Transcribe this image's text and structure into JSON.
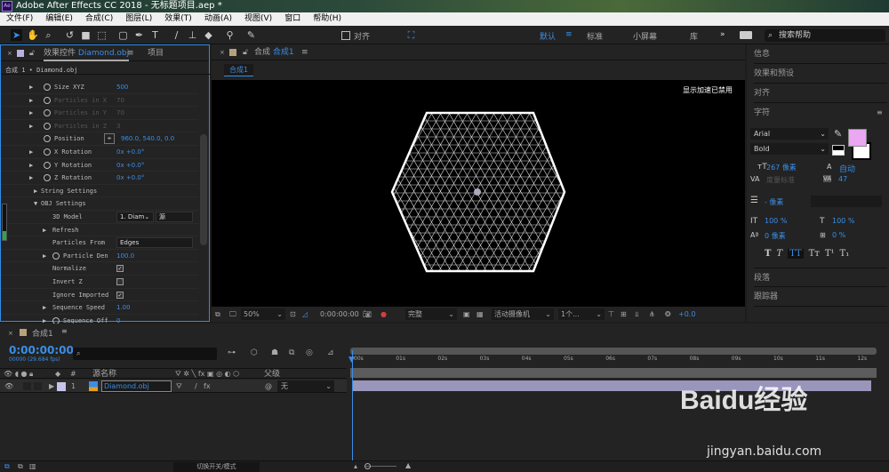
{
  "app": {
    "logo": "Ae",
    "title": "Adobe After Effects CC 2018 - 无标题项目.aep *"
  },
  "menu": [
    "文件(F)",
    "编辑(E)",
    "合成(C)",
    "图层(L)",
    "效果(T)",
    "动画(A)",
    "视图(V)",
    "窗口",
    "帮助(H)"
  ],
  "toolbar": {
    "align_label": "对齐",
    "workspaces": [
      "默认",
      "标准",
      "小屏幕",
      "库"
    ],
    "more": "»",
    "search_placeholder": "搜索帮助"
  },
  "effects_panel": {
    "tab_label": "效果控件",
    "layer_name": "Diamond.obj",
    "project_tab": "项目",
    "breadcrumb": "合成 1 • Diamond.obj",
    "rows": [
      {
        "label": "Size XYZ",
        "value": "500"
      },
      {
        "label": "Particles in X",
        "value": "70"
      },
      {
        "label": "Particles in Y",
        "value": "70"
      },
      {
        "label": "Particles in Z",
        "value": "3"
      },
      {
        "label": "Position",
        "value": "960.0, 540.0, 0.0"
      },
      {
        "label": "X Rotation",
        "value": "0x +0.0°"
      },
      {
        "label": "Y Rotation",
        "value": "0x +0.0°"
      },
      {
        "label": "Z Rotation",
        "value": "0x +0.0°"
      },
      {
        "label": "String Settings"
      },
      {
        "label": "OBJ Settings"
      },
      {
        "label": "3D Model",
        "value": "1. Diam",
        "value2": "源"
      },
      {
        "label": "Refresh"
      },
      {
        "label": "Particles From",
        "value": "Edges"
      },
      {
        "label": "Particle Den",
        "value": "100.0"
      },
      {
        "label": "Normalize",
        "checked": true
      },
      {
        "label": "Invert Z",
        "checked": false
      },
      {
        "label": "Ignore Imported",
        "checked": true
      },
      {
        "label": "Sequence Speed",
        "value": "1.00"
      },
      {
        "label": "Sequence Off",
        "value": "0"
      }
    ]
  },
  "viewer": {
    "tab_prefix": "合成",
    "comp_name": "合成1",
    "subtab": "合成1",
    "gpu_notice": "显示加速已禁用",
    "zoom": "50%",
    "timecode": "0:00:00:00",
    "resolution": "完整",
    "camera": "活动摄像机",
    "views": "1个...",
    "exposure": "+0.0"
  },
  "right_panel": {
    "info": "信息",
    "effects_presets": "效果和预设",
    "align": "对齐",
    "character": "字符",
    "font": "Arial",
    "style": "Bold",
    "fill_color": "#e9a8ef",
    "size": "267 像素",
    "leading": "自动",
    "kerning": "度量标准",
    "tracking": "47",
    "stroke": "- 像素",
    "vscale": "100 %",
    "hscale": "100 %",
    "baseline": "0 像素",
    "tsume": "0 %",
    "text_styles": [
      "T",
      "T",
      "TT",
      "Tт",
      "T¹",
      "T₁"
    ],
    "paragraph": "段落",
    "tracker": "跟踪器"
  },
  "timeline": {
    "comp_name": "合成1",
    "timecode": "0:00:00:00",
    "frames": "00000 (29.684 fps)",
    "columns": {
      "number": "#",
      "source": "源名称",
      "parent": "父级"
    },
    "layers": [
      {
        "number": "1",
        "name": "Diamond.obj",
        "parent": "无"
      }
    ],
    "ruler": [
      "00s",
      "01s",
      "02s",
      "03s",
      "04s",
      "05s",
      "06s",
      "07s",
      "08s",
      "09s",
      "10s",
      "11s",
      "12s"
    ],
    "toggle_label": "切换开关/模式"
  },
  "watermark": {
    "brand": "Baidu经验",
    "url": "jingyan.baidu.com"
  }
}
